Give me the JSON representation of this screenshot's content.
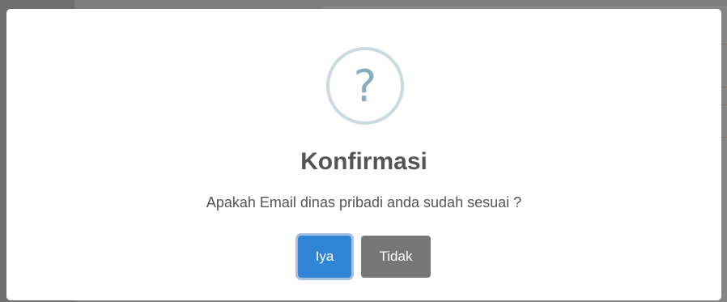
{
  "dialog": {
    "icon": "question-icon",
    "icon_glyph": "?",
    "title": "Konfirmasi",
    "message": "Apakah Email dinas pribadi anda sudah sesuai ?",
    "confirm_label": "Iya",
    "cancel_label": "Tidak"
  },
  "colors": {
    "confirm_button": "#3085d6",
    "cancel_button": "#777777",
    "icon_border": "#c9dae1",
    "icon_glyph": "#87adbd",
    "text": "#545454"
  }
}
